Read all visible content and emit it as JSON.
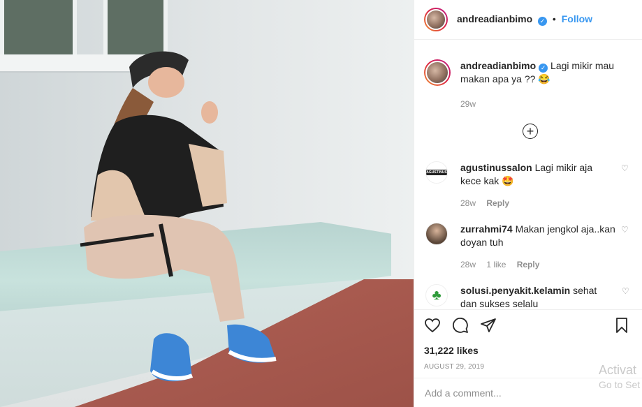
{
  "post": {
    "username": "andreadianbimo",
    "follow_label": "Follow",
    "dot": "•",
    "caption_text": "Lagi mikir mau makan apa ya ?? 😂",
    "caption_time": "29w",
    "likes": "31,222 likes",
    "date": "AUGUST 29, 2019",
    "comment_placeholder": "Add a comment..."
  },
  "comments": [
    {
      "username": "agustinussalon",
      "text": "Lagi mikir aja kece kak 🤩",
      "time": "28w",
      "likes": "",
      "reply_label": "Reply",
      "avatar_text": "AGUSTINUS"
    },
    {
      "username": "zurrahmi74",
      "text": "Makan jengkol aja..kan doyan tuh",
      "time": "28w",
      "likes": "1 like",
      "reply_label": "Reply"
    },
    {
      "username": "solusi.penyakit.kelamin",
      "text": "sehat dan sukses selalu"
    }
  ],
  "watermark": {
    "line1": "Activat",
    "line2": "Go to Set"
  },
  "icons": {
    "verified": "verified-badge-icon",
    "load_more": "plus-circle-icon",
    "like": "heart-icon",
    "comment": "comment-bubble-icon",
    "share": "paper-plane-icon",
    "save": "bookmark-icon"
  },
  "colors": {
    "link": "#3897f0",
    "muted": "#8e8e8e",
    "text": "#262626"
  }
}
